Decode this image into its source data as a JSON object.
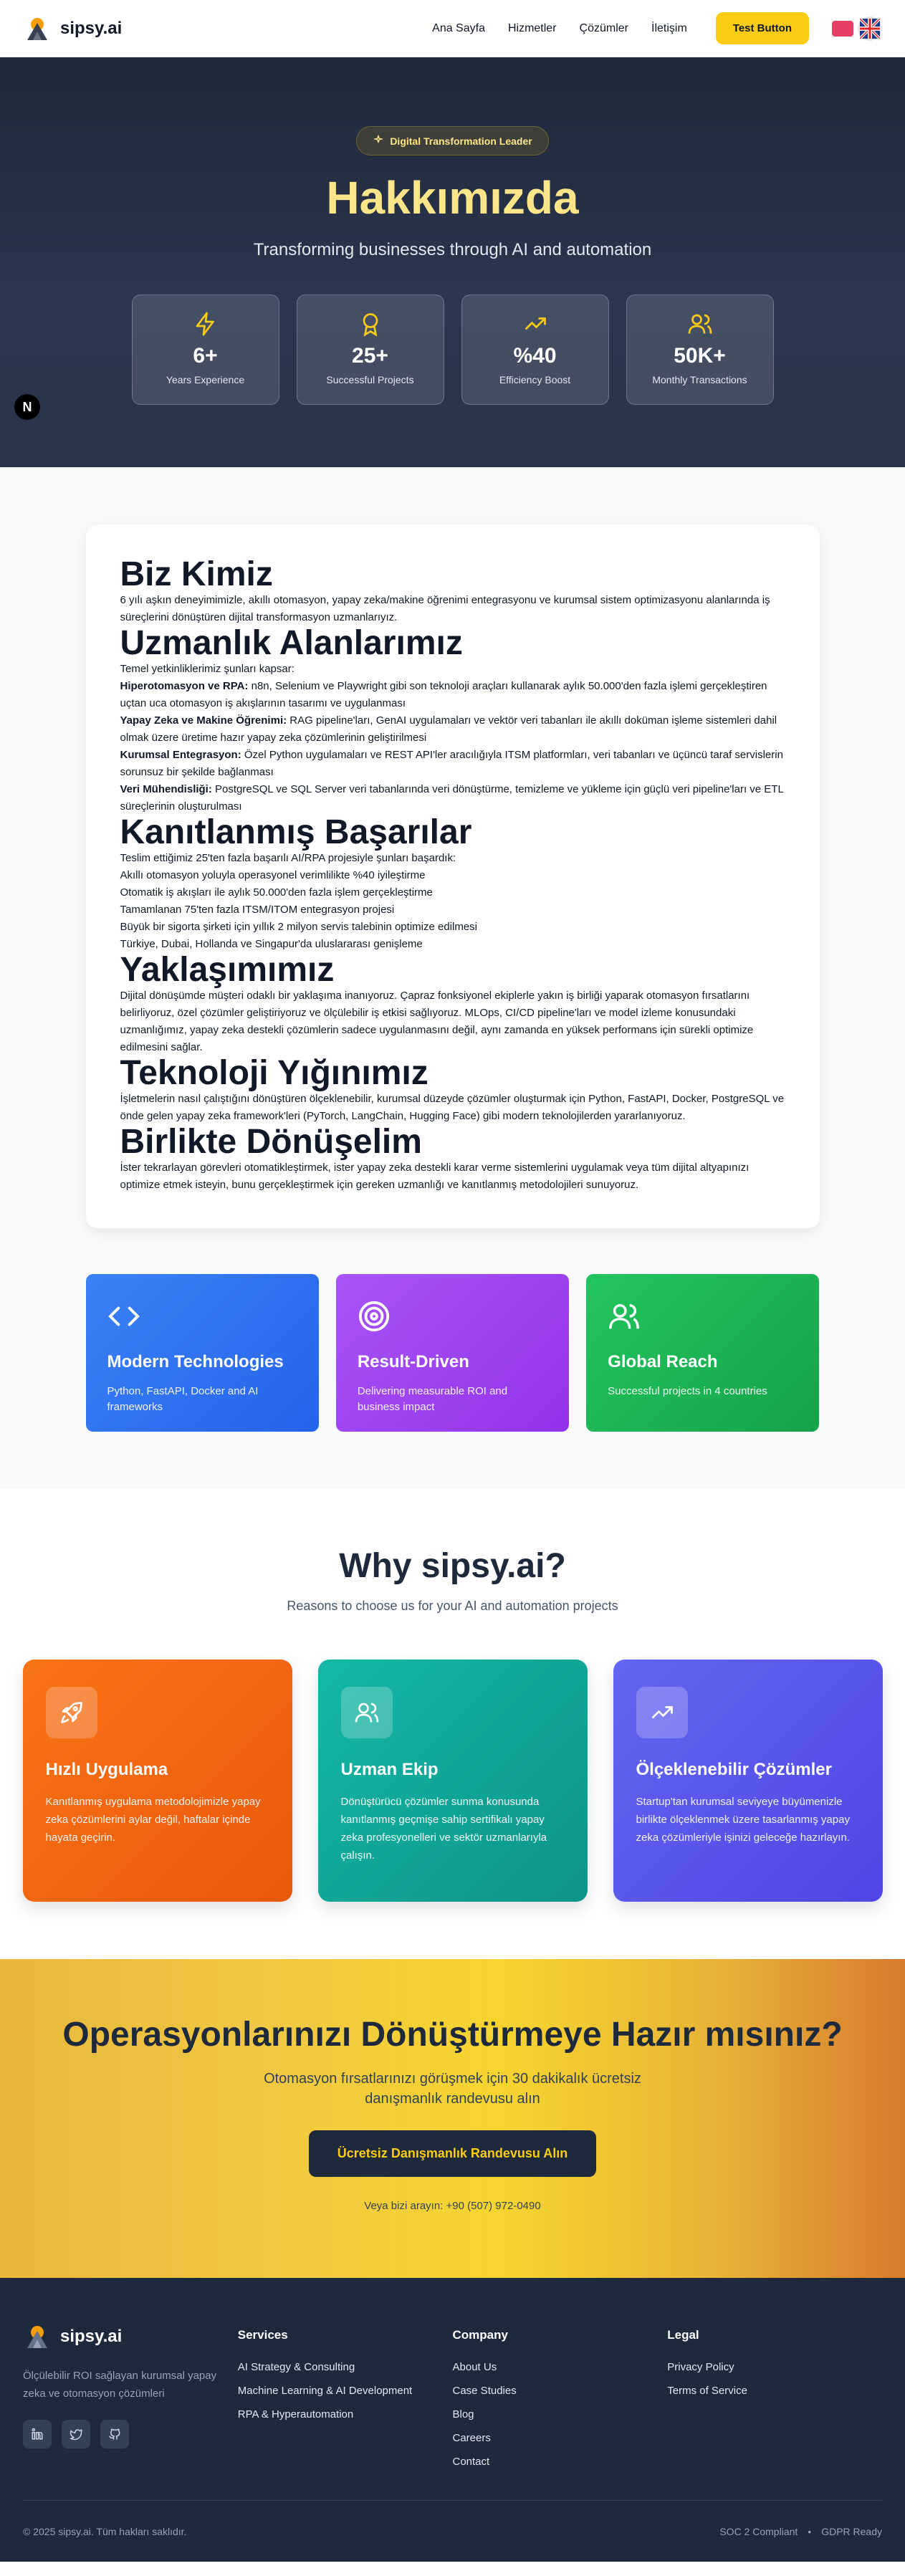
{
  "nav": {
    "brand": "sipsy.ai",
    "links": [
      "Ana Sayfa",
      "Hizmetler",
      "Çözümler",
      "İletişim"
    ],
    "cta": "Test Button",
    "flags": [
      "tr-flag-icon",
      "gb-flag-icon"
    ]
  },
  "hero": {
    "badge": "Digital Transformation Leader",
    "title": "Hakkımızda",
    "subtitle": "Transforming businesses through AI and automation",
    "stats": [
      {
        "icon": "lightning-icon",
        "value": "6+",
        "label": "Years Experience"
      },
      {
        "icon": "award-icon",
        "value": "25+",
        "label": "Successful Projects"
      },
      {
        "icon": "trending-up-icon",
        "value": "%40",
        "label": "Efficiency Boost"
      },
      {
        "icon": "users-icon",
        "value": "50K+",
        "label": "Monthly Transactions"
      }
    ],
    "dev_badge": "N"
  },
  "about": {
    "sections": [
      {
        "title": "Biz Kimiz",
        "lines": [
          {
            "text": "6 yılı aşkın deneyimimizle, akıllı otomasyon, yapay zeka/makine öğrenimi entegrasyonu ve kurumsal sistem optimizasyonu alanlarında iş süreçlerini dönüştüren dijital transformasyon uzmanlarıyız."
          }
        ]
      },
      {
        "title": "Uzmanlık Alanlarımız",
        "lines": [
          {
            "text": "Temel yetkinliklerimiz şunları kapsar:"
          },
          {
            "bold": "Hiperotomasyon ve RPA:",
            "text": " n8n, Selenium ve Playwright gibi son teknoloji araçları kullanarak aylık 50.000'den fazla işlemi gerçekleştiren uçtan uca otomasyon iş akışlarının tasarımı ve uygulanması"
          },
          {
            "bold": "Yapay Zeka ve Makine Öğrenimi:",
            "text": " RAG pipeline'ları, GenAI uygulamaları ve vektör veri tabanları ile akıllı doküman işleme sistemleri dahil olmak üzere üretime hazır yapay zeka çözümlerinin geliştirilmesi"
          },
          {
            "bold": "Kurumsal Entegrasyon:",
            "text": " Özel Python uygulamaları ve REST API'ler aracılığıyla ITSM platformları, veri tabanları ve üçüncü taraf servislerin sorunsuz bir şekilde bağlanması"
          },
          {
            "bold": "Veri Mühendisliği:",
            "text": " PostgreSQL ve SQL Server veri tabanlarında veri dönüştürme, temizleme ve yükleme için güçlü veri pipeline'ları ve ETL süreçlerinin oluşturulması"
          }
        ]
      },
      {
        "title": "Kanıtlanmış Başarılar",
        "lines": [
          {
            "text": "Teslim ettiğimiz 25'ten fazla başarılı AI/RPA projesiyle şunları başardık:"
          },
          {
            "text": "Akıllı otomasyon yoluyla operasyonel verimlilikte %40 iyileştirme"
          },
          {
            "text": "Otomatik iş akışları ile aylık 50.000'den fazla işlem gerçekleştirme"
          },
          {
            "text": "Tamamlanan 75'ten fazla ITSM/ITOM entegrasyon projesi"
          },
          {
            "text": "Büyük bir sigorta şirketi için yıllık 2 milyon servis talebinin optimize edilmesi"
          },
          {
            "text": "Türkiye, Dubai, Hollanda ve Singapur'da uluslararası genişleme"
          }
        ]
      },
      {
        "title": "Yaklaşımımız",
        "lines": [
          {
            "text": "Dijital dönüşümde müşteri odaklı bir yaklaşıma inanıyoruz. Çapraz fonksiyonel ekiplerle yakın iş birliği yaparak otomasyon fırsatlarını belirliyoruz, özel çözümler geliştiriyoruz ve ölçülebilir iş etkisi sağlıyoruz. MLOps, CI/CD pipeline'ları ve model izleme konusundaki uzmanlığımız, yapay zeka destekli çözümlerin sadece uygulanmasını değil, aynı zamanda en yüksek performans için sürekli optimize edilmesini sağlar."
          }
        ]
      },
      {
        "title": "Teknoloji Yığınımız",
        "lines": [
          {
            "text": "İşletmelerin nasıl çalıştığını dönüştüren ölçeklenebilir, kurumsal düzeyde çözümler oluşturmak için Python, FastAPI, Docker, PostgreSQL ve önde gelen yapay zeka framework'leri (PyTorch, LangChain, Hugging Face) gibi modern teknolojilerden yararlanıyoruz."
          }
        ]
      },
      {
        "title": "Birlikte Dönüşelim",
        "lines": [
          {
            "text": "İster tekrarlayan görevleri otomatikleştirmek, ister yapay zeka destekli karar verme sistemlerini uygulamak veya tüm dijital altyapınızı optimize etmek isteyin, bunu gerçekleştirmek için gereken uzmanlığı ve kanıtlanmış metodolojileri sunuyoruz."
          }
        ]
      }
    ],
    "features": [
      {
        "icon": "code-icon",
        "title": "Modern Technologies",
        "text": "Python, FastAPI, Docker and AI frameworks",
        "color": "#2563eb"
      },
      {
        "icon": "target-icon",
        "title": "Result-Driven",
        "text": "Delivering measurable ROI and business impact",
        "color": "#9333ea"
      },
      {
        "icon": "users-icon",
        "title": "Global Reach",
        "text": "Successful projects in 4 countries",
        "color": "#16a34a"
      }
    ]
  },
  "why": {
    "title": "Why sipsy.ai?",
    "subtitle": "Reasons to choose us for your AI and automation projects",
    "cards": [
      {
        "icon": "rocket-icon",
        "title": "Hızlı Uygulama",
        "text": "Kanıtlanmış uygulama metodolojimizle yapay zeka çözümlerini aylar değil, haftalar içinde hayata geçirin.",
        "color": "#ea580c"
      },
      {
        "icon": "users-icon",
        "title": "Uzman Ekip",
        "text": "Dönüştürücü çözümler sunma konusunda kanıtlanmış geçmişe sahip sertifikalı yapay zeka profesyonelleri ve sektör uzmanlarıyla çalışın.",
        "color": "#0d9488"
      },
      {
        "icon": "trending-up-icon",
        "title": "Ölçeklenebilir Çözümler",
        "text": "Startup'tan kurumsal seviyeye büyümenizle birlikte ölçeklenmek üzere tasarlanmış yapay zeka çözümleriyle işinizi geleceğe hazırlayın.",
        "color": "#4f46e5"
      }
    ]
  },
  "cta": {
    "title": "Operasyonlarınızı Dönüştürmeye Hazır mısınız?",
    "subtitle": "Otomasyon fırsatlarınızı görüşmek için 30 dakikalık ücretsiz danışmanlık randevusu alın",
    "button": "Ücretsiz Danışmanlık Randevusu Alın",
    "phone": "Veya bizi arayın: +90 (507) 972-0490"
  },
  "footer": {
    "brand": "sipsy.ai",
    "tagline": "Ölçülebilir ROI sağlayan kurumsal yapay zeka ve otomasyon çözümleri",
    "social": [
      "linkedin-icon",
      "twitter-icon",
      "github-icon"
    ],
    "columns": [
      {
        "title": "Services",
        "items": [
          "AI Strategy & Consulting",
          "Machine Learning & AI Development",
          "RPA & Hyperautomation"
        ]
      },
      {
        "title": "Company",
        "items": [
          "About Us",
          "Case Studies",
          "Blog",
          "Careers",
          "Contact"
        ]
      },
      {
        "title": "Legal",
        "items": [
          "Privacy Policy",
          "Terms of Service"
        ]
      }
    ],
    "copyright": "© 2025 sipsy.ai. Tüm hakları saklıdır.",
    "badges": [
      "SOC 2 Compliant",
      "GDPR Ready"
    ]
  }
}
